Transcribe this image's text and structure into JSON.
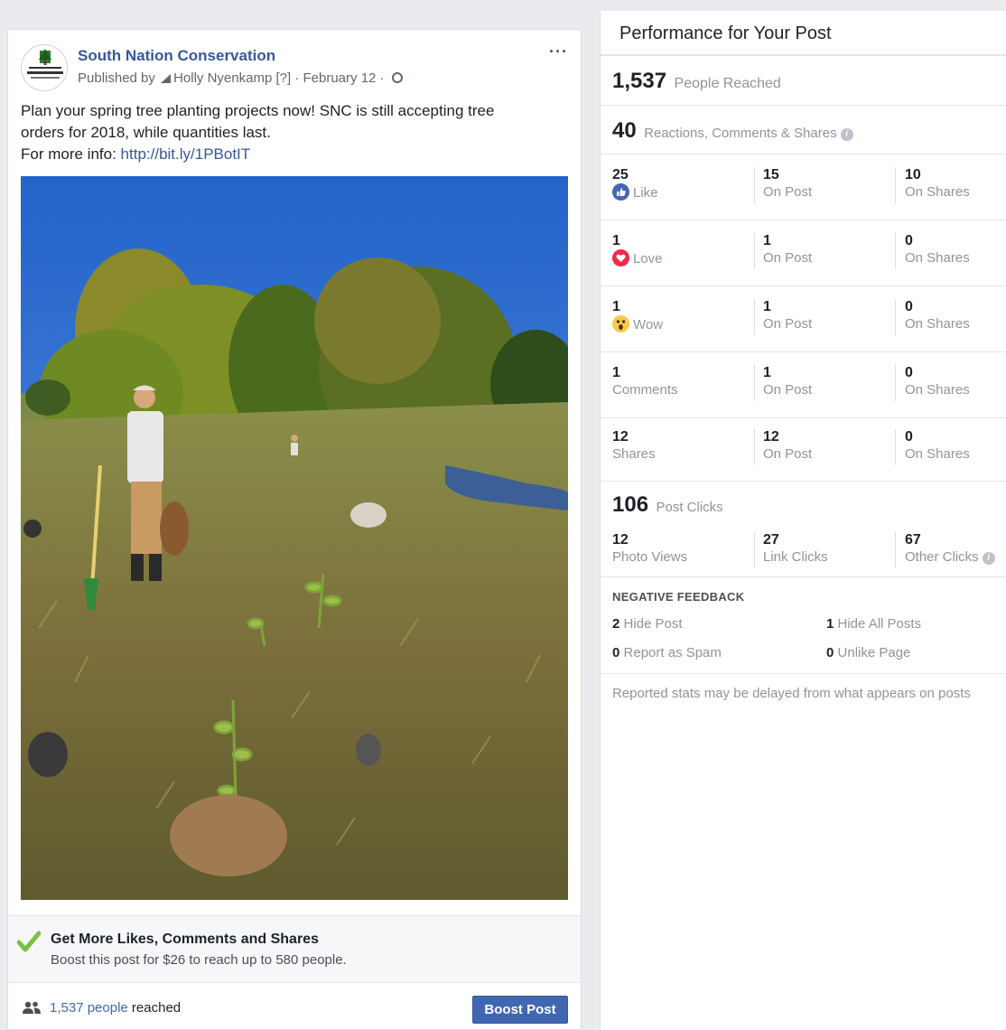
{
  "post": {
    "page_name": "South Nation Conservation",
    "published_by_prefix": "Published by",
    "author": "Holly Nyenkamp",
    "help_marker": "[?]",
    "date": "February 12",
    "more_label": "···",
    "text_line1": "Plan your spring tree planting projects now! SNC is still accepting tree",
    "text_line2": "orders for 2018, while quantities last.",
    "more_info_label": "For more info:",
    "link": "http://bit.ly/1PBotIT",
    "boost_title": "Get More Likes, Comments and Shares",
    "boost_subtitle": "Boost this post for $26 to reach up to 580 people.",
    "reached_count": "1,537 people",
    "reached_suffix": "reached",
    "boost_button": "Boost Post",
    "avatar_text": "SOUTH NATION CONSERVATION"
  },
  "panel": {
    "title": "Performance for Your Post",
    "people_reached": {
      "value": "1,537",
      "label": "People Reached"
    },
    "engagement": {
      "value": "40",
      "label": "Reactions, Comments & Shares"
    },
    "rows": [
      {
        "total": "25",
        "label": "Like",
        "icon": "like-icon",
        "on_post": "15",
        "on_post_label": "On Post",
        "on_shares": "10",
        "on_shares_label": "On Shares"
      },
      {
        "total": "1",
        "label": "Love",
        "icon": "love-icon",
        "on_post": "1",
        "on_post_label": "On Post",
        "on_shares": "0",
        "on_shares_label": "On Shares"
      },
      {
        "total": "1",
        "label": "Wow",
        "icon": "wow-icon",
        "on_post": "1",
        "on_post_label": "On Post",
        "on_shares": "0",
        "on_shares_label": "On Shares"
      },
      {
        "total": "1",
        "label": "Comments",
        "on_post": "1",
        "on_post_label": "On Post",
        "on_shares": "0",
        "on_shares_label": "On Shares"
      },
      {
        "total": "12",
        "label": "Shares",
        "on_post": "12",
        "on_post_label": "On Post",
        "on_shares": "0",
        "on_shares_label": "On Shares"
      }
    ],
    "post_clicks": {
      "value": "106",
      "label": "Post Clicks"
    },
    "clicks": [
      {
        "value": "12",
        "label": "Photo Views"
      },
      {
        "value": "27",
        "label": "Link Clicks"
      },
      {
        "value": "67",
        "label": "Other Clicks"
      }
    ],
    "negative": {
      "title": "NEGATIVE FEEDBACK",
      "hide_post": {
        "value": "2",
        "label": "Hide Post"
      },
      "hide_all": {
        "value": "1",
        "label": "Hide All Posts"
      },
      "spam": {
        "value": "0",
        "label": "Report as Spam"
      },
      "unlike": {
        "value": "0",
        "label": "Unlike Page"
      }
    },
    "note": "Reported stats may be delayed from what appears on posts"
  },
  "colors": {
    "accent": "#4267b2",
    "link": "#365899",
    "love": "#f0284a",
    "wow": "#f7c94c",
    "check": "#7bc043"
  }
}
